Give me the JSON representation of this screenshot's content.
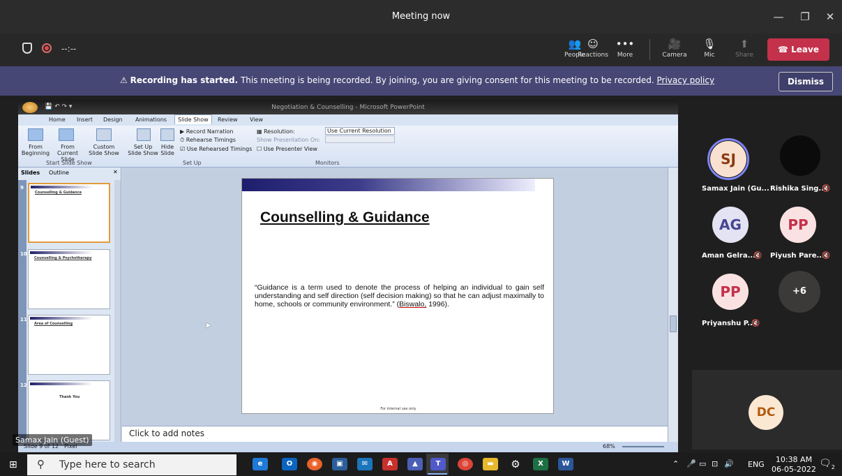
{
  "window": {
    "title": "Meeting now",
    "minimize": "—",
    "maximize": "❐",
    "close": "✕"
  },
  "toolbar": {
    "timer": "--:--",
    "items": [
      {
        "label": "People",
        "icon": "people-icon",
        "glyph": "👥"
      },
      {
        "label": "Reactions",
        "icon": "reactions-icon",
        "glyph": "☺"
      },
      {
        "label": "More",
        "icon": "more-icon",
        "glyph": "•••"
      },
      {
        "label": "Camera",
        "icon": "camera-off-icon",
        "glyph": "🎥"
      },
      {
        "label": "Mic",
        "icon": "mic-off-icon",
        "glyph": "🎙"
      },
      {
        "label": "Share",
        "icon": "share-icon",
        "glyph": "⬆"
      }
    ],
    "leave_label": "Leave",
    "leave_color": "#c4314b"
  },
  "banner": {
    "bold": "Recording has started.",
    "text": " This meeting is being recorded. By joining, you are giving consent for this meeting to be recorded. ",
    "link": "Privacy policy",
    "dismiss": "Dismiss",
    "color": "#464775"
  },
  "powerpoint": {
    "window_title": "Negotiation & Counselling - Microsoft PowerPoint",
    "tabs": [
      "Home",
      "Insert",
      "Design",
      "Animations",
      "Slide Show",
      "Review",
      "View"
    ],
    "active_tab": "Slide Show",
    "ribbon": {
      "from_beginning": "From Beginning",
      "from_current": "From Current Slide",
      "custom": "Custom Slide Show",
      "group_start": "Start Slide Show",
      "setup": "Set Up Slide Show",
      "hide": "Hide Slide",
      "record": "Record Narration",
      "rehearse": "Rehearse Timings",
      "use_rehearsed": "Use Rehearsed Timings",
      "group_setup": "Set Up",
      "resolution_label": "Resolution:",
      "resolution_value": "Use Current Resolution",
      "show_on": "Show Presentation On:",
      "presenter_view": "Use Presenter View",
      "group_monitors": "Monitors"
    },
    "pane_tabs": [
      "Slides",
      "Outline"
    ],
    "thumbnails": [
      {
        "num": "9",
        "title": "Counselling & Guidance"
      },
      {
        "num": "10",
        "title": "Counselling & Psychotherapy"
      },
      {
        "num": "11",
        "title": "Area of Counselling"
      },
      {
        "num": "12",
        "title": "Thank You"
      }
    ],
    "slide": {
      "title": "Counselling & Guidance",
      "body": "“Guidance is a term used to denote the process of helping an individual to gain self understanding and self direction (self decision making) so that he can adjust maximally to home, schools or community environment.” (",
      "cite": "Biswalo,",
      "body_end": " 1996).",
      "footer": "For internal use only"
    },
    "notes_placeholder": "Click to add notes",
    "status": "Slide 9 of 12",
    "theme": "Pixel",
    "zoom": "68%"
  },
  "presenter_label": "Samax Jain (Guest)",
  "participants": [
    {
      "initials": "SJ",
      "name": "Samax Jain (Gu...",
      "bg": "#f9e1d1",
      "fg": "#8a3a12",
      "muted": false,
      "speaking": true
    },
    {
      "initials": "",
      "name": "Rishika Sing...",
      "bg": "#0b0b0b",
      "fg": "#fff",
      "muted": true,
      "speaking": false
    },
    {
      "initials": "AG",
      "name": "Aman Gelra...",
      "bg": "#e4e3f3",
      "fg": "#444791",
      "muted": true,
      "speaking": false
    },
    {
      "initials": "PP",
      "name": "Piyush Pare...",
      "bg": "#fbe2e2",
      "fg": "#c4314b",
      "muted": true,
      "speaking": false
    },
    {
      "initials": "PP",
      "name": "Priyanshu P...",
      "bg": "#fbe2e2",
      "fg": "#c4314b",
      "muted": true,
      "speaking": false
    },
    {
      "initials": "+6",
      "name": "",
      "bg": "#3b3a39",
      "fg": "#fff",
      "muted": false,
      "speaking": false
    }
  ],
  "self_tile": {
    "initials": "DC",
    "bg": "#fbe8d3",
    "fg": "#b15a0b"
  },
  "taskbar": {
    "search_placeholder": "Type here to search",
    "lang": "ENG",
    "time": "10:38 AM",
    "date": "06-05-2022",
    "notifications": "2"
  }
}
